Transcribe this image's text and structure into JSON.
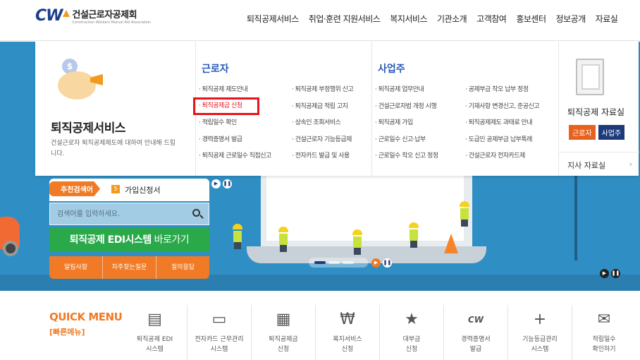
{
  "header": {
    "logo_cw": "CW",
    "logo_name": "건설근로자공제회",
    "logo_sub": "Construction Workers Mutual Aid Association",
    "nav": [
      "퇴직공제서비스",
      "취업·훈련 지원서비스",
      "복지서비스",
      "기관소개",
      "고객참여",
      "홍보센터",
      "정보공개",
      "자료실"
    ]
  },
  "mega": {
    "title": "퇴직공제서비스",
    "desc": "건설근로자 퇴직공제제도에 대하여 안내해 드립니다.",
    "coin": "$",
    "worker": {
      "heading": "근로자",
      "links": [
        "· 퇴직공제 제도안내",
        "· 퇴직공제 부정행위 신고",
        "· 퇴직공제금 신청",
        "· 퇴직공제금 적립 고지",
        "· 적립일수 확인",
        "· 상속인 조회서비스",
        "· 경력증명서 발급",
        "· 건설근로자 기능등급제",
        "· 퇴직공제 근로일수 직접신고",
        "· 전자카드 발급 및 사용"
      ]
    },
    "business": {
      "heading": "사업주",
      "links": [
        "· 퇴직공제 업무안내",
        "· 공제부금 착오 납부 정정",
        "· 건설근로자법 개정 시행",
        "· 기재사항 변경신고, 준공신고",
        "· 퇴직공제 가입",
        "· 퇴직공제제도 과태료 안내",
        "· 근로일수 신고·납부",
        "· 도급인 공제부금 납부특례",
        "· 근로일수 착오 신고 정정",
        "· 건설근로자 전자카드제"
      ]
    },
    "data": {
      "title": "퇴직공제 자료실",
      "btn_worker": "근로자",
      "btn_business": "사업주",
      "branch": "지사 자료실",
      "branch_arrow": "›"
    }
  },
  "search": {
    "rec_tag": "추천검색어",
    "rec_num": "5",
    "rec_word": "가입신청서",
    "placeholder": "검색어를 입력하세요.",
    "edi_bold": "퇴직공제 EDI시스템",
    "edi_rest": " 바로가기",
    "sub_buttons": [
      "알림사항",
      "자주찾는질문",
      "질의응답"
    ]
  },
  "controls": {
    "play": "▶",
    "pause": "❚❚"
  },
  "quick": {
    "title": "QUICK MENU",
    "subtitle": "[빠른메뉴]",
    "items": [
      {
        "icon": "document-icon",
        "glyph": "▤",
        "label": "퇴직공제 EDI\n시스템"
      },
      {
        "icon": "card-icon",
        "glyph": "▭",
        "label": "전자카드 근무관리\n시스템"
      },
      {
        "icon": "calendar-icon",
        "glyph": "▦",
        "label": "퇴직공제금\n신청"
      },
      {
        "icon": "won-icon",
        "glyph": "₩",
        "label": "복지서비스\n신청"
      },
      {
        "icon": "click-icon",
        "glyph": "★",
        "label": "대부금\n신청"
      },
      {
        "icon": "cw-icon",
        "glyph": "CW",
        "label": "경력증명서\n발급"
      },
      {
        "icon": "skill-plus-icon",
        "glyph": "+",
        "label": "기능등급관리\n시스템"
      },
      {
        "icon": "book-icon",
        "glyph": "✉",
        "label": "적립일수\n확인하기"
      }
    ]
  }
}
